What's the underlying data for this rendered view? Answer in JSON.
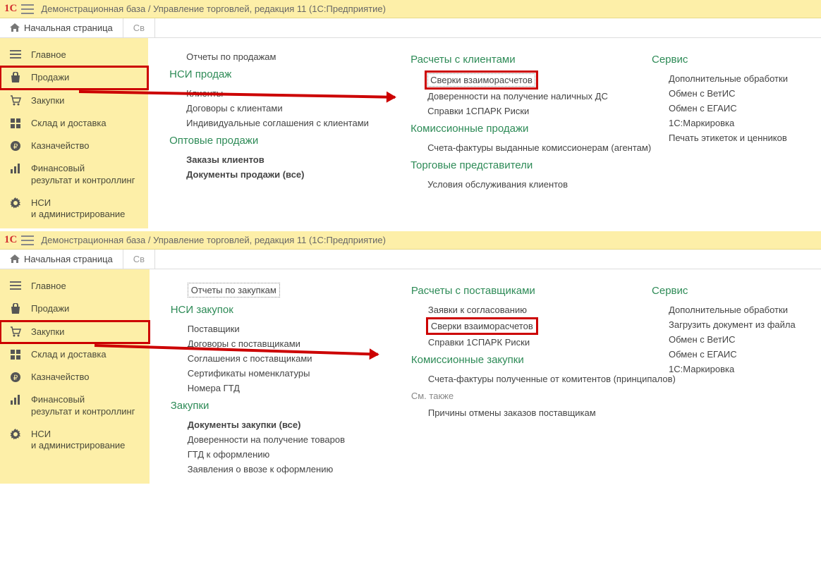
{
  "common": {
    "header_title": "Демонстрационная база / Управление торговлей, редакция 11   (1С:Предприятие)",
    "home_tab": "Начальная страница",
    "partial_tab1": "Св",
    "partial_tab2": "Св",
    "sidebar": [
      {
        "icon": "menu",
        "label": "Главное"
      },
      {
        "icon": "bag",
        "label": "Продажи"
      },
      {
        "icon": "cart",
        "label": "Закупки"
      },
      {
        "icon": "grid",
        "label": "Склад и доставка"
      },
      {
        "icon": "ruble",
        "label": "Казначейство"
      },
      {
        "icon": "bars",
        "label": "Финансовый\nрезультат и контроллинг"
      },
      {
        "icon": "gear",
        "label": "НСИ\nи администрирование"
      }
    ]
  },
  "panel1": {
    "highlight_index": 1,
    "col1": [
      {
        "type": "link",
        "text": "Отчеты по продажам"
      },
      {
        "type": "title",
        "text": "НСИ продаж"
      },
      {
        "type": "link",
        "text": "Клиенты"
      },
      {
        "type": "link",
        "text": "Договоры с клиентами"
      },
      {
        "type": "link",
        "text": "Индивидуальные соглашения с клиентами"
      },
      {
        "type": "title",
        "text": "Оптовые продажи"
      },
      {
        "type": "link",
        "text": "Заказы клиентов",
        "bold": true
      },
      {
        "type": "link",
        "text": "Документы продажи (все)",
        "bold": true
      }
    ],
    "col2": [
      {
        "type": "title",
        "text": "Расчеты с клиентами"
      },
      {
        "type": "link",
        "text": "Сверки взаиморасчетов",
        "boxed": true
      },
      {
        "type": "link",
        "text": "Доверенности на получение наличных ДС"
      },
      {
        "type": "link",
        "text": "Справки 1СПАРК Риски"
      },
      {
        "type": "title",
        "text": "Комиссионные продажи"
      },
      {
        "type": "link",
        "text": "Счета-фактуры выданные комиссионерам (агентам)"
      },
      {
        "type": "title",
        "text": "Торговые представители"
      },
      {
        "type": "link",
        "text": "Условия обслуживания клиентов"
      }
    ],
    "col3": [
      {
        "type": "title",
        "text": "Сервис"
      },
      {
        "type": "link",
        "text": "Дополнительные обработки"
      },
      {
        "type": "link",
        "text": "Обмен с ВетИС"
      },
      {
        "type": "link",
        "text": "Обмен с ЕГАИС"
      },
      {
        "type": "link",
        "text": "1С:Маркировка"
      },
      {
        "type": "link",
        "text": "Печать этикеток и ценников"
      }
    ]
  },
  "panel2": {
    "highlight_index": 2,
    "col1": [
      {
        "type": "link",
        "text": "Отчеты по закупкам",
        "dotted": true
      },
      {
        "type": "title",
        "text": "НСИ закупок"
      },
      {
        "type": "link",
        "text": "Поставщики"
      },
      {
        "type": "link",
        "text": "Договоры с поставщиками"
      },
      {
        "type": "link",
        "text": "Соглашения с поставщиками"
      },
      {
        "type": "link",
        "text": "Сертификаты номенклатуры"
      },
      {
        "type": "link",
        "text": "Номера ГТД"
      },
      {
        "type": "title",
        "text": "Закупки"
      },
      {
        "type": "link",
        "text": "Документы закупки (все)",
        "bold": true
      },
      {
        "type": "link",
        "text": "Доверенности на получение товаров"
      },
      {
        "type": "link",
        "text": "ГТД к оформлению"
      },
      {
        "type": "link",
        "text": "Заявления о ввозе к оформлению"
      }
    ],
    "col2": [
      {
        "type": "title",
        "text": "Расчеты с поставщиками"
      },
      {
        "type": "link",
        "text": "Заявки к согласованию"
      },
      {
        "type": "link",
        "text": "Сверки взаиморасчетов",
        "boxed2": true
      },
      {
        "type": "link",
        "text": "Справки 1СПАРК Риски"
      },
      {
        "type": "title",
        "text": "Комиссионные закупки"
      },
      {
        "type": "link",
        "text": "Счета-фактуры полученные от комитентов (принципалов)"
      },
      {
        "type": "gray",
        "text": "См. также"
      },
      {
        "type": "link",
        "text": "Причины отмены заказов поставщикам"
      }
    ],
    "col3": [
      {
        "type": "title",
        "text": "Сервис"
      },
      {
        "type": "link",
        "text": "Дополнительные обработки"
      },
      {
        "type": "link",
        "text": "Загрузить документ из файла"
      },
      {
        "type": "link",
        "text": "Обмен с ВетИС"
      },
      {
        "type": "link",
        "text": "Обмен с ЕГАИС"
      },
      {
        "type": "link",
        "text": "1С:Маркировка"
      }
    ]
  }
}
